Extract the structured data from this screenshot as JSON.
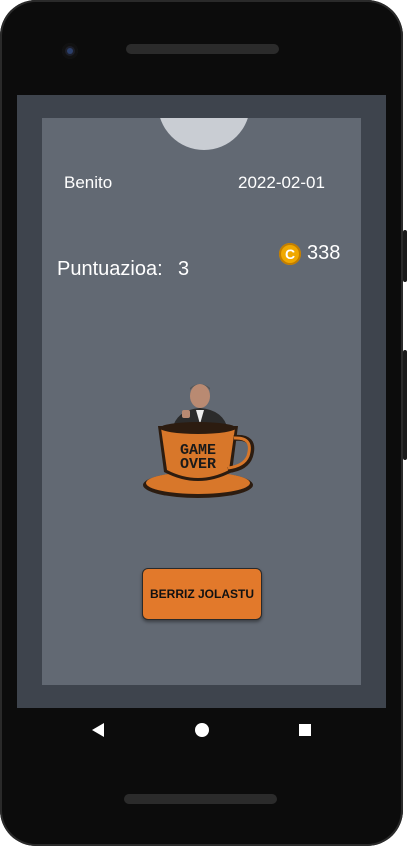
{
  "header": {
    "user_name": "Benito",
    "date": "2022-02-01"
  },
  "coins": {
    "icon_letter": "C",
    "amount": "338"
  },
  "score": {
    "label": "Puntuazioa:",
    "value": "3"
  },
  "game_over": {
    "line1": "GAME",
    "line2": "OVER"
  },
  "actions": {
    "restart_label": "BERRIZ JOLASTU"
  },
  "colors": {
    "card_bg": "#626973",
    "button": "#e2792b",
    "cup": "#d8772a",
    "coin": "#f0a800"
  }
}
